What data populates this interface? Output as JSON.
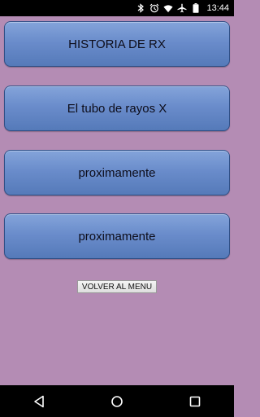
{
  "status_bar": {
    "time": "13:44",
    "icons": [
      "bluetooth-icon",
      "alarm-icon",
      "wifi-icon",
      "airplane-icon",
      "battery-icon"
    ]
  },
  "menu": {
    "items": [
      {
        "label": "HISTORIA DE RX"
      },
      {
        "label": "El tubo de rayos X"
      },
      {
        "label": "proximamente"
      },
      {
        "label": "proximamente"
      }
    ],
    "back_label": "VOLVER AL MENU"
  },
  "nav_bar": {
    "icons": [
      "back-icon",
      "home-icon",
      "recents-icon"
    ]
  },
  "colors": {
    "background": "#b48cb4",
    "button_top": "#84a4da",
    "button_bottom": "#557ab9",
    "bars": "#000000"
  }
}
